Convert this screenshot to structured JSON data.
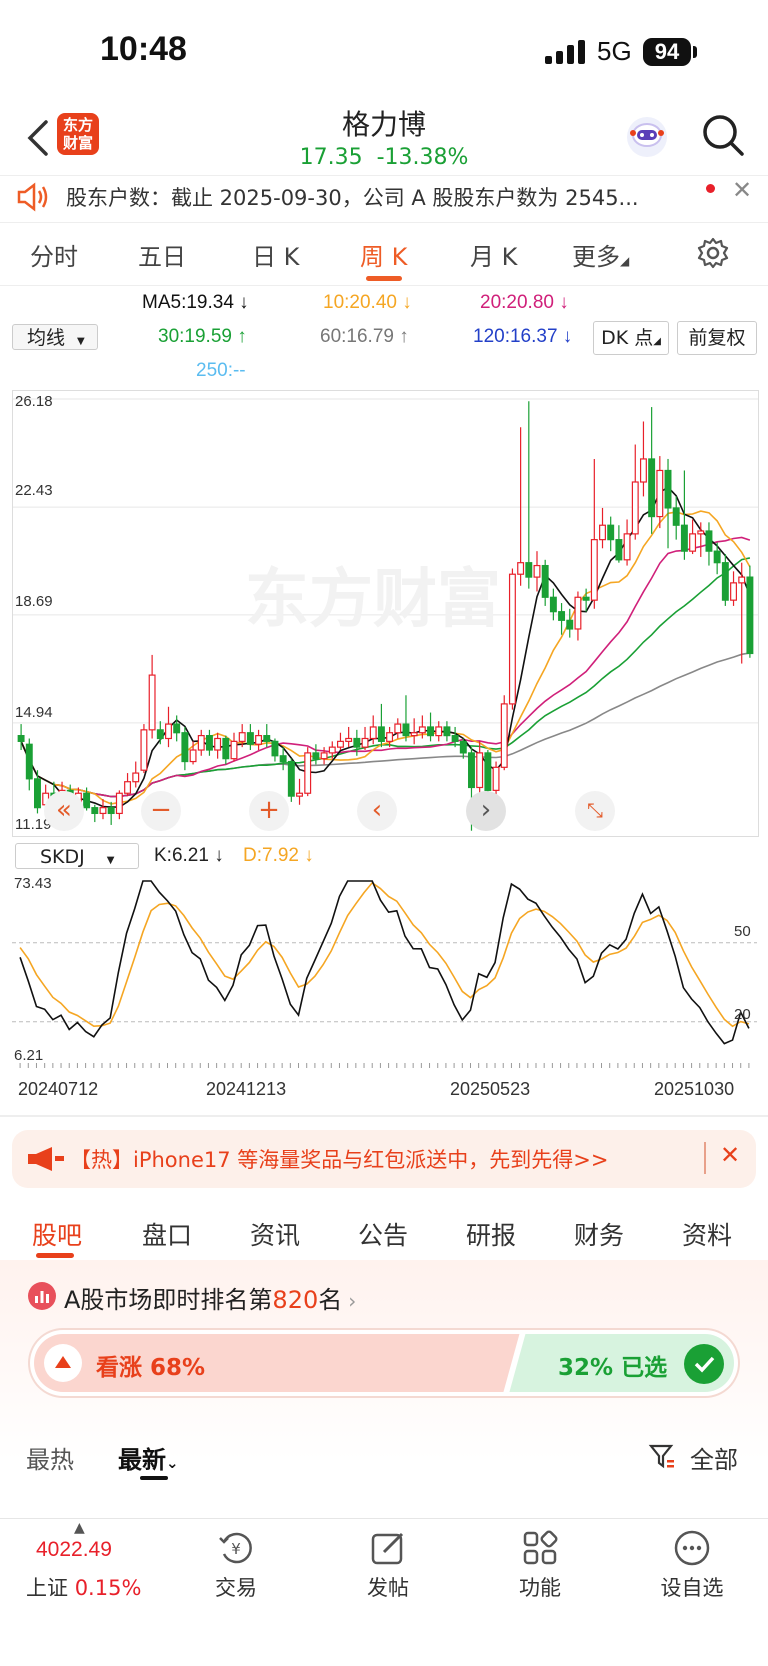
{
  "status": {
    "time": "10:48",
    "network": "5G",
    "battery": "94"
  },
  "header": {
    "logo_line1": "东方",
    "logo_line2": "财富",
    "name": "格力博",
    "price": "17.35",
    "change": "-13.38%"
  },
  "notice": {
    "text": "股东户数：截止 2025-09-30，公司 A 股股东户数为 2545..."
  },
  "period_tabs": [
    "分时",
    "五日",
    "日 K",
    "周 K",
    "月 K",
    "更多"
  ],
  "ma": {
    "selector": "均线",
    "ma5": "MA5:19.34 ↓",
    "ma10": "10:20.40 ↓",
    "ma20": "20:20.80 ↓",
    "ma30": "30:19.59 ↑",
    "ma60": "60:16.79 ↑",
    "ma120": "120:16.37 ↓",
    "ma250": "250:--",
    "dk_button": "DK 点",
    "fq_button": "前复权"
  },
  "colors": {
    "up": "#e8202a",
    "down": "#1aa035",
    "accent": "#ee5c26",
    "ma5": "#111111",
    "ma10": "#f5a623",
    "ma20": "#d0207a",
    "ma30": "#1aa035",
    "ma60": "#888888",
    "ma120": "#2340c8",
    "ma250": "#5bbcf0"
  },
  "y_axis": [
    "26.18",
    "22.43",
    "18.69",
    "14.94",
    "11.19"
  ],
  "kdj": {
    "selector": "SKDJ",
    "k": "K:6.21 ↓",
    "d": "D:7.92 ↓",
    "top": "73.43",
    "bottom": "6.21",
    "level50": "50",
    "level20": "20"
  },
  "dates": [
    "20240712",
    "20241213",
    "20250523",
    "20251030"
  ],
  "chart_data": {
    "type": "candlestick",
    "ylim": [
      11.19,
      26.18
    ],
    "candles": [
      [
        14.5,
        14.3,
        14.9,
        14.0
      ],
      [
        14.2,
        13.0,
        14.4,
        12.6
      ],
      [
        13.0,
        12.0,
        13.3,
        11.8
      ],
      [
        12.1,
        12.5,
        12.8,
        11.9
      ],
      [
        12.5,
        12.2,
        12.9,
        12.0
      ],
      [
        12.2,
        12.6,
        12.9,
        11.9
      ],
      [
        12.6,
        11.9,
        12.8,
        11.7
      ],
      [
        11.9,
        12.5,
        12.7,
        11.8
      ],
      [
        12.5,
        12.0,
        12.7,
        11.9
      ],
      [
        12.0,
        11.8,
        12.1,
        11.5
      ],
      [
        11.8,
        12.0,
        12.3,
        11.6
      ],
      [
        12.0,
        11.8,
        12.2,
        11.4
      ],
      [
        11.8,
        12.5,
        12.6,
        11.6
      ],
      [
        12.5,
        12.9,
        13.2,
        12.4
      ],
      [
        12.9,
        13.2,
        13.6,
        12.7
      ],
      [
        13.3,
        14.7,
        14.9,
        13.2
      ],
      [
        14.7,
        16.6,
        17.3,
        14.4
      ],
      [
        14.7,
        14.4,
        15.0,
        14.2
      ],
      [
        14.4,
        14.9,
        15.5,
        14.1
      ],
      [
        14.9,
        14.6,
        15.2,
        14.3
      ],
      [
        14.6,
        13.6,
        14.8,
        13.3
      ],
      [
        13.6,
        14.0,
        14.3,
        13.5
      ],
      [
        14.0,
        14.5,
        14.7,
        13.8
      ],
      [
        14.5,
        14.0,
        14.7,
        13.8
      ],
      [
        14.0,
        14.4,
        14.6,
        13.7
      ],
      [
        14.4,
        13.7,
        14.5,
        13.5
      ],
      [
        13.7,
        14.3,
        14.6,
        13.6
      ],
      [
        14.3,
        14.6,
        14.9,
        14.1
      ],
      [
        14.6,
        14.2,
        14.9,
        14.0
      ],
      [
        14.2,
        14.5,
        14.7,
        14.0
      ],
      [
        14.5,
        14.3,
        14.9,
        14.1
      ],
      [
        14.3,
        13.8,
        14.4,
        13.6
      ],
      [
        13.8,
        13.6,
        14.1,
        13.3
      ],
      [
        13.6,
        12.4,
        13.7,
        12.2
      ],
      [
        12.4,
        12.5,
        13.0,
        12.1
      ],
      [
        12.5,
        13.9,
        14.1,
        12.4
      ],
      [
        13.9,
        13.7,
        14.2,
        13.5
      ],
      [
        13.7,
        13.9,
        14.1,
        13.5
      ],
      [
        13.9,
        14.1,
        14.3,
        13.7
      ],
      [
        14.1,
        14.3,
        14.6,
        14.0
      ],
      [
        14.3,
        14.4,
        14.8,
        14.1
      ],
      [
        14.4,
        14.1,
        14.7,
        13.8
      ],
      [
        14.1,
        14.4,
        14.8,
        14.0
      ],
      [
        14.4,
        14.8,
        15.2,
        14.2
      ],
      [
        14.8,
        14.3,
        15.6,
        14.1
      ],
      [
        14.3,
        14.6,
        14.8,
        14.1
      ],
      [
        14.6,
        14.9,
        15.1,
        14.4
      ],
      [
        14.9,
        14.5,
        15.9,
        14.3
      ],
      [
        14.5,
        14.6,
        15.1,
        14.2
      ],
      [
        14.6,
        14.8,
        15.2,
        14.4
      ],
      [
        14.8,
        14.5,
        15.3,
        14.3
      ],
      [
        14.5,
        14.8,
        15.0,
        14.3
      ],
      [
        14.8,
        14.5,
        15.0,
        14.3
      ],
      [
        14.5,
        14.3,
        14.8,
        14.1
      ],
      [
        14.3,
        13.9,
        14.4,
        13.7
      ],
      [
        13.9,
        12.7,
        14.1,
        11.2
      ],
      [
        12.7,
        13.9,
        14.3,
        12.5
      ],
      [
        13.9,
        12.6,
        14.0,
        12.3
      ],
      [
        12.6,
        13.4,
        13.6,
        12.4
      ],
      [
        13.4,
        15.6,
        15.9,
        13.3
      ],
      [
        15.6,
        20.1,
        20.3,
        15.4
      ],
      [
        20.1,
        20.5,
        25.2,
        19.7
      ],
      [
        20.5,
        20.0,
        26.1,
        19.6
      ],
      [
        20.0,
        20.4,
        20.9,
        19.5
      ],
      [
        20.4,
        19.3,
        20.6,
        19.0
      ],
      [
        19.3,
        18.8,
        19.6,
        18.5
      ],
      [
        18.8,
        18.5,
        19.1,
        18.0
      ],
      [
        18.5,
        18.2,
        18.9,
        17.9
      ],
      [
        18.2,
        19.3,
        19.5,
        17.8
      ],
      [
        19.3,
        19.2,
        19.6,
        18.8
      ],
      [
        19.2,
        21.3,
        24.1,
        18.9
      ],
      [
        21.3,
        21.8,
        22.4,
        21.0
      ],
      [
        21.8,
        21.3,
        22.1,
        20.9
      ],
      [
        21.3,
        20.6,
        21.8,
        20.5
      ],
      [
        20.6,
        21.5,
        22.0,
        20.4
      ],
      [
        21.5,
        23.3,
        24.6,
        21.3
      ],
      [
        23.3,
        24.1,
        25.4,
        22.8
      ],
      [
        24.1,
        22.1,
        25.9,
        21.5
      ],
      [
        22.1,
        23.7,
        24.2,
        21.7
      ],
      [
        23.7,
        22.4,
        24.1,
        21.0
      ],
      [
        22.4,
        21.8,
        22.8,
        21.3
      ],
      [
        21.8,
        20.9,
        23.7,
        20.6
      ],
      [
        20.9,
        21.5,
        22.0,
        20.8
      ],
      [
        21.5,
        21.6,
        21.9,
        20.7
      ],
      [
        21.6,
        20.9,
        21.9,
        20.4
      ],
      [
        20.9,
        20.5,
        21.2,
        20.1
      ],
      [
        20.5,
        19.2,
        20.8,
        19.0
      ],
      [
        19.2,
        19.8,
        20.2,
        19.0
      ],
      [
        19.8,
        20.0,
        20.5,
        17.0
      ],
      [
        20.0,
        17.35,
        20.4,
        17.2
      ]
    ]
  }
}
